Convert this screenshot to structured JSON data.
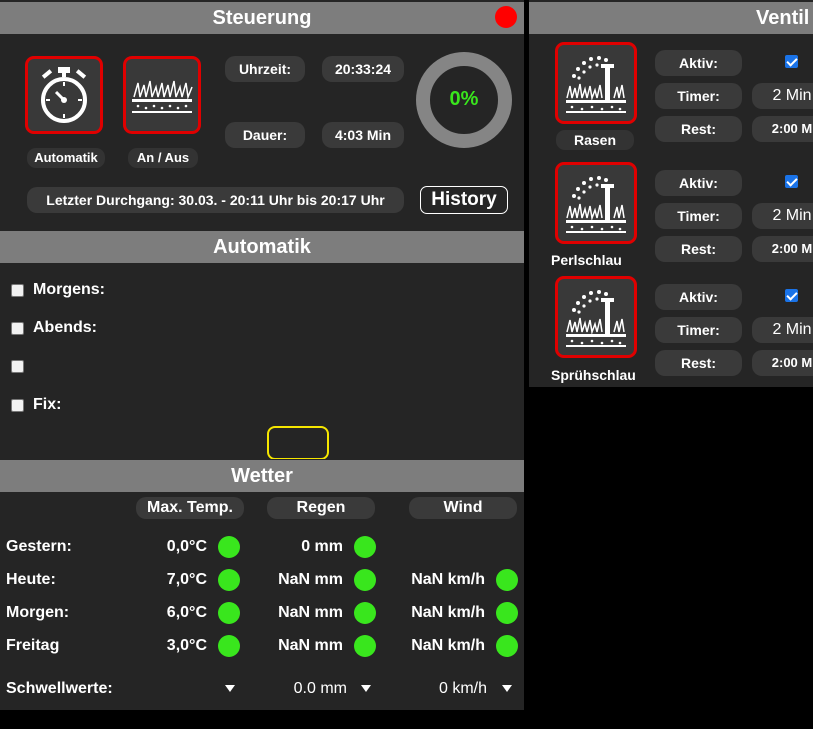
{
  "steuerung": {
    "title": "Steuerung",
    "buttons": [
      {
        "label": "Automatik",
        "icon": "stopwatch-icon"
      },
      {
        "label": "An / Aus",
        "icon": "lawn-icon"
      }
    ],
    "uhrzeit_label": "Uhrzeit:",
    "uhrzeit_value": "20:33:24",
    "dauer_label": "Dauer:",
    "dauer_value": "4:03 Min",
    "progress_text": "0%",
    "progress_value": 0,
    "last_run": "Letzter Durchgang: 30.03. - 20:11 Uhr bis 20:17 Uhr",
    "history_label": "History",
    "status_color": "#ff0000"
  },
  "automatik": {
    "title": "Automatik",
    "options": [
      {
        "label": "Morgens:",
        "checked": false
      },
      {
        "label": "Abends:",
        "checked": false
      },
      {
        "label": "",
        "checked": false
      },
      {
        "label": "Fix:",
        "checked": false
      }
    ]
  },
  "wetter": {
    "title": "Wetter",
    "headers": [
      "Max. Temp.",
      "Regen",
      "Wind"
    ],
    "rows": [
      {
        "day": "Gestern:",
        "temp": "0,0°C",
        "rain": "0 mm",
        "wind": ""
      },
      {
        "day": "Heute:",
        "temp": "7,0°C",
        "rain": "NaN mm",
        "wind": "NaN km/h"
      },
      {
        "day": "Morgen:",
        "temp": "6,0°C",
        "rain": "NaN mm",
        "wind": "NaN km/h"
      },
      {
        "day": "Freitag",
        "temp": "3,0°C",
        "rain": "NaN mm",
        "wind": "NaN km/h"
      }
    ],
    "threshold_label": "Schwellwerte:",
    "threshold_temp": "",
    "threshold_rain": "0.0 mm",
    "threshold_wind": "0 km/h",
    "indicator_color": "#39e61d"
  },
  "ventile": {
    "title": "Ventil",
    "aktiv_label": "Aktiv:",
    "timer_label": "Timer:",
    "rest_label": "Rest:",
    "items": [
      {
        "name": "Rasen",
        "aktiv": true,
        "timer": "2 Min",
        "rest": "2:00 M"
      },
      {
        "name": "Perlschlau",
        "aktiv": true,
        "timer": "2 Min",
        "rest": "2:00 M"
      },
      {
        "name": "Sprühschlau",
        "aktiv": true,
        "timer": "2 Min",
        "rest": "2:00 M"
      }
    ]
  }
}
